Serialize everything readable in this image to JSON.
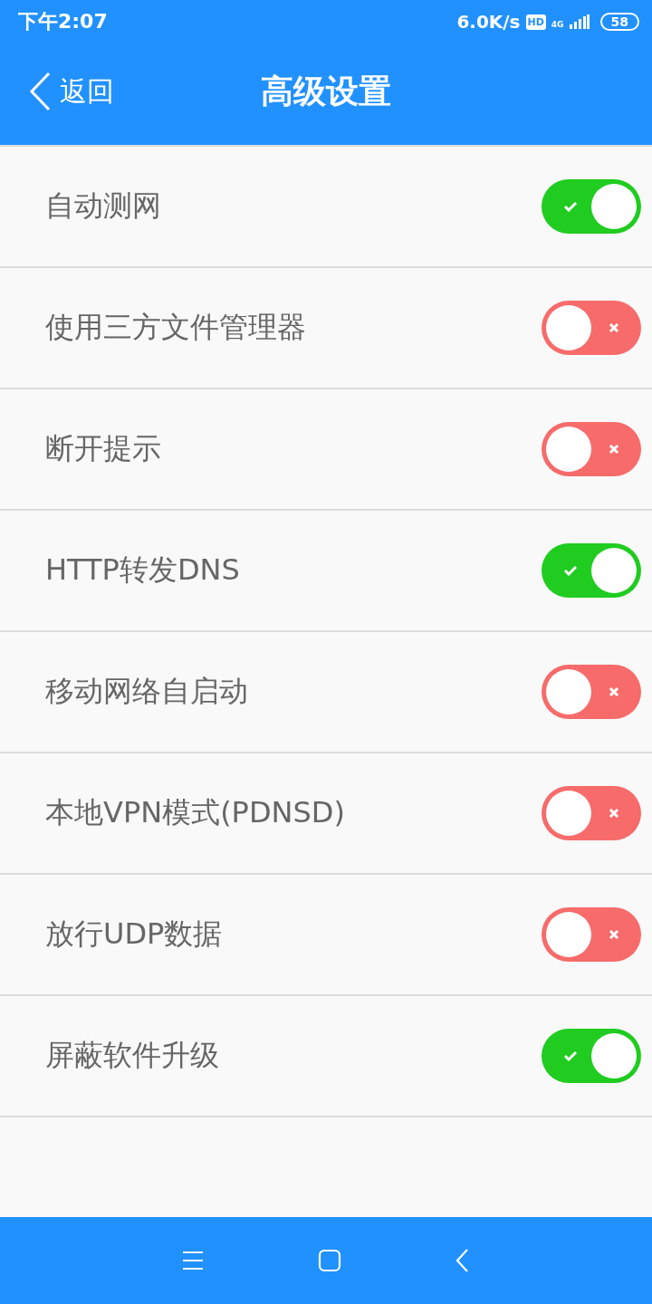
{
  "status_bar": {
    "time": "下午2:07",
    "speed": "6.0K/s",
    "hd": "HD",
    "network": "4G",
    "battery": "58"
  },
  "header": {
    "back": "返回",
    "title": "高级设置"
  },
  "settings": [
    {
      "label": "自动测网",
      "on": true
    },
    {
      "label": "使用三方文件管理器",
      "on": false
    },
    {
      "label": "断开提示",
      "on": false
    },
    {
      "label": "HTTP转发DNS",
      "on": true
    },
    {
      "label": "移动网络自启动",
      "on": false
    },
    {
      "label": "本地VPN模式(PDNSD)",
      "on": false
    },
    {
      "label": "放行UDP数据",
      "on": false
    },
    {
      "label": "屏蔽软件升级",
      "on": true
    }
  ]
}
